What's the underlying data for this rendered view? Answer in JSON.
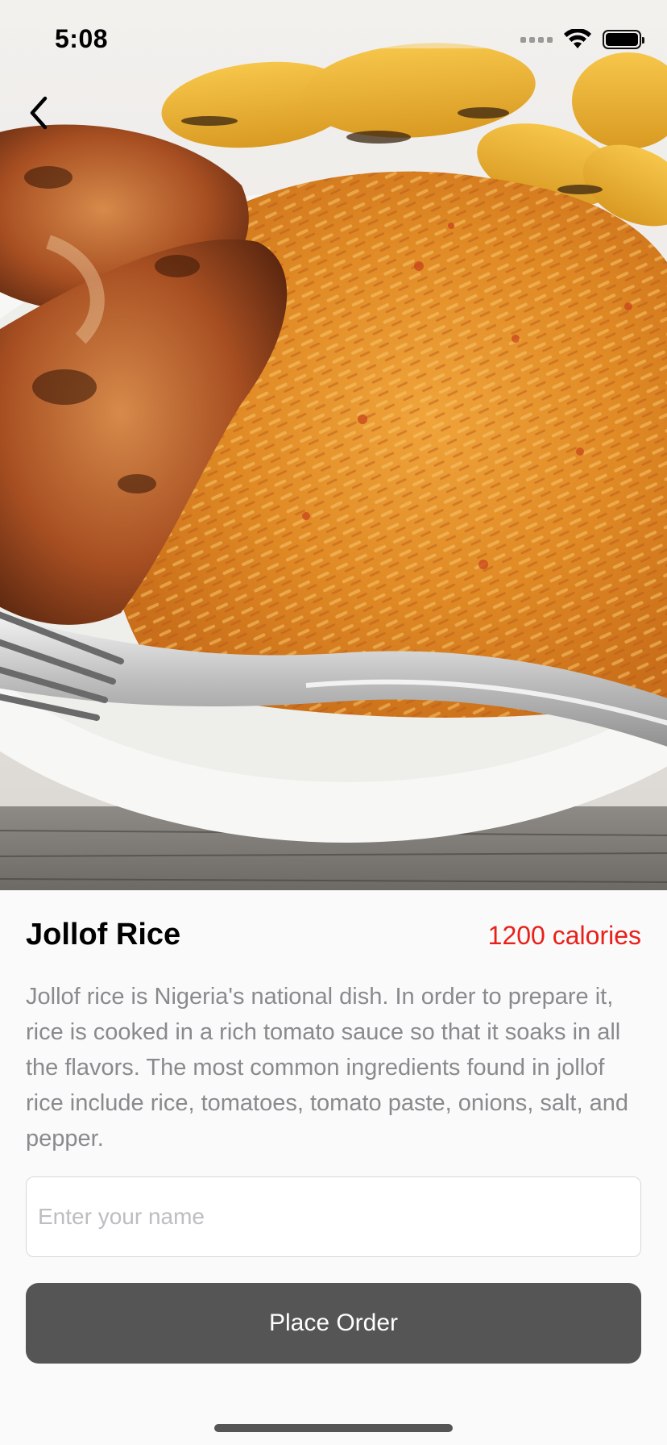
{
  "status_bar": {
    "time": "5:08",
    "icons": [
      "signal-icon",
      "wifi-icon",
      "battery-icon"
    ]
  },
  "navigation": {
    "back_icon": "chevron-left-icon"
  },
  "hero": {
    "image": "jollof-rice-photo"
  },
  "dish": {
    "title": "Jollof Rice",
    "calories": "1200 calories",
    "description": "Jollof rice is Nigeria's national dish. In order to prepare it, rice is cooked in a rich tomato sauce so that it soaks in all the flavors. The most common ingredients found in jollof rice include rice, tomatoes, tomato paste, onions, salt, and pepper."
  },
  "form": {
    "name_value": "",
    "name_placeholder": "Enter your name",
    "order_label": "Place Order"
  },
  "colors": {
    "accent_calories": "#e8201b",
    "button_bg": "#555555",
    "text_secondary": "#8a8a8e"
  }
}
